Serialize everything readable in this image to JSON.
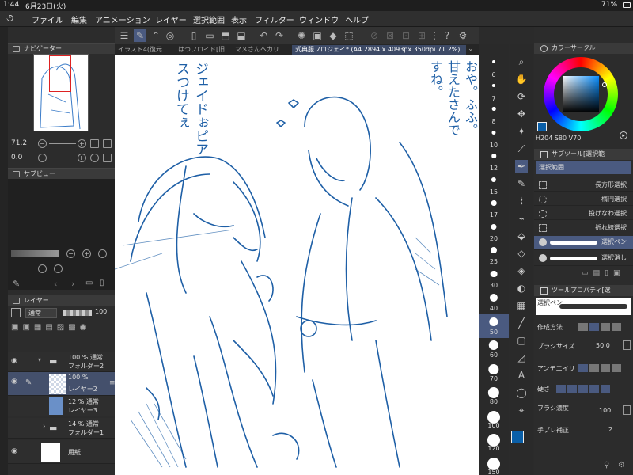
{
  "status": {
    "time": "1:44",
    "date": "6月23日(火)",
    "battery": "71%"
  },
  "menu": [
    "ファイル",
    "編集",
    "アニメーション",
    "レイヤー",
    "選択範囲",
    "表示",
    "フィルター",
    "ウィンドウ",
    "ヘルプ"
  ],
  "tabs": [
    {
      "label": "イラスト4(復元",
      "active": false
    },
    {
      "label": "はつフロイド[旧",
      "active": false
    },
    {
      "label": "マメさんヘカリ",
      "active": false
    },
    {
      "label": "式典服フロジェイ* (A4 2894 x 4093px 350dpi 71.2%)",
      "active": true
    }
  ],
  "navigator": {
    "title": "ナビゲーター",
    "zoom": "71.2",
    "rotation": "0.0"
  },
  "subview": {
    "title": "サブビュー"
  },
  "layers": {
    "title": "レイヤー",
    "blend": "通常",
    "opacity": "100",
    "items": [
      {
        "percent": "100 % 通常",
        "name": "フォルダー2",
        "selected": false
      },
      {
        "percent": "100 %",
        "name": "レイヤー2",
        "selected": true
      },
      {
        "percent": "12 % 通常",
        "name": "レイヤー3",
        "selected": false
      },
      {
        "percent": "14 % 通常",
        "name": "フォルダー1",
        "selected": false
      },
      {
        "percent": "",
        "name": "用紙",
        "selected": false
      }
    ]
  },
  "brush_sizes": [
    "6",
    "7",
    "8",
    "10",
    "12",
    "15",
    "17",
    "20",
    "25",
    "30",
    "40",
    "50",
    "60",
    "70",
    "80",
    "100",
    "120",
    "150"
  ],
  "selected_brush_size": "50",
  "tools": [
    "search-icon",
    "hand-icon",
    "rotate-icon",
    "move-icon",
    "sparkle-icon",
    "eyedropper-icon",
    "pen-icon",
    "pencil-icon",
    "brush-icon",
    "airbrush-icon",
    "fill-icon",
    "eraser-icon",
    "blend-icon",
    "bucket-icon",
    "gradient-icon",
    "line-icon",
    "frame-icon",
    "ruler-icon",
    "text-icon",
    "balloon-icon",
    "correct-icon"
  ],
  "color_circle": {
    "title": "カラーサークル",
    "h": "204",
    "s": "80",
    "v": "70",
    "main_color": "#0a5fa8"
  },
  "subtool": {
    "title": "サブツール[選択範",
    "group": "選択範囲",
    "items": [
      "長方形選択",
      "楕円選択",
      "投げなわ選択",
      "折れ線選択",
      "選択ペン",
      "選択消し"
    ],
    "selected": "選択ペン"
  },
  "tool_property": {
    "title": "ツールプロパティ[選",
    "preview_label": "選択ペン",
    "method_label": "作成方法",
    "brush_size_label": "ブラシサイズ",
    "brush_size": "50.0",
    "antialias_label": "アンチエイリ",
    "hardness_label": "硬さ",
    "density_label": "ブラシ濃度",
    "density": "100",
    "stabilizer_label": "手ブレ補正",
    "stabilizer": "2"
  },
  "canvas_text": {
    "left": "ジェイドぉピアスつけてぇ",
    "right": "おや。ふふ。甘えたさんですね。"
  }
}
